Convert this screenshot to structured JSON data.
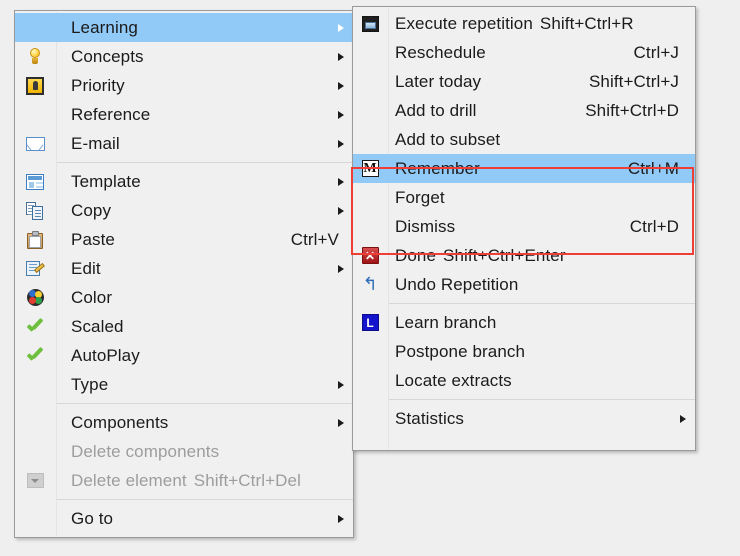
{
  "background_color": "#efefef",
  "highlight_color": "#91c9f7",
  "annotation": {
    "color": "#ef3e36",
    "target_items": [
      "Remember",
      "Forget",
      "Dismiss"
    ]
  },
  "left_menu": {
    "name": "element-context-menu",
    "items": [
      {
        "label": "Learning",
        "icon": "none",
        "shortcut": "",
        "submenu": true,
        "highlight": true,
        "disabled": false
      },
      {
        "label": "Concepts",
        "icon": "bulb-icon",
        "shortcut": "",
        "submenu": true,
        "highlight": false,
        "disabled": false
      },
      {
        "label": "Priority",
        "icon": "priority-icon",
        "shortcut": "",
        "submenu": true,
        "highlight": false,
        "disabled": false
      },
      {
        "label": "Reference",
        "icon": "none",
        "shortcut": "",
        "submenu": true,
        "highlight": false,
        "disabled": false
      },
      {
        "label": "E-mail",
        "icon": "mail-icon",
        "shortcut": "",
        "submenu": true,
        "highlight": false,
        "disabled": false
      },
      {
        "separator": true
      },
      {
        "label": "Template",
        "icon": "template-icon",
        "shortcut": "",
        "submenu": true,
        "highlight": false,
        "disabled": false
      },
      {
        "label": "Copy",
        "icon": "copy-icon",
        "shortcut": "",
        "submenu": true,
        "highlight": false,
        "disabled": false
      },
      {
        "label": "Paste",
        "icon": "paste-icon",
        "shortcut": "Ctrl+V",
        "submenu": false,
        "highlight": false,
        "disabled": false
      },
      {
        "label": "Edit",
        "icon": "edit-icon",
        "shortcut": "",
        "submenu": true,
        "highlight": false,
        "disabled": false
      },
      {
        "label": "Color",
        "icon": "color-icon",
        "shortcut": "",
        "submenu": false,
        "highlight": false,
        "disabled": false
      },
      {
        "label": "Scaled",
        "icon": "check-icon",
        "shortcut": "",
        "submenu": false,
        "highlight": false,
        "disabled": false
      },
      {
        "label": "AutoPlay",
        "icon": "check-icon",
        "shortcut": "",
        "submenu": false,
        "highlight": false,
        "disabled": false
      },
      {
        "label": "Type",
        "icon": "none",
        "shortcut": "",
        "submenu": true,
        "highlight": false,
        "disabled": false
      },
      {
        "separator": true
      },
      {
        "label": "Components",
        "icon": "none",
        "shortcut": "",
        "submenu": true,
        "highlight": false,
        "disabled": false
      },
      {
        "label": "Delete components",
        "icon": "none",
        "shortcut": "",
        "submenu": false,
        "highlight": false,
        "disabled": true
      },
      {
        "label": "Delete element",
        "icon": "dropbtn-icon",
        "shortcut": "Shift+Ctrl+Del",
        "submenu": false,
        "highlight": false,
        "disabled": true,
        "inline_shortcut": true
      },
      {
        "separator": true
      },
      {
        "label": "Go to",
        "icon": "none",
        "shortcut": "",
        "submenu": true,
        "highlight": false,
        "disabled": false
      }
    ]
  },
  "right_menu": {
    "name": "learning-submenu",
    "items": [
      {
        "label": "Execute repetition",
        "icon": "exec-icon",
        "shortcut": "Shift+Ctrl+R",
        "submenu": false,
        "highlight": false,
        "disabled": false,
        "inline_shortcut": true
      },
      {
        "label": "Reschedule",
        "icon": "none",
        "shortcut": "Ctrl+J",
        "submenu": false,
        "highlight": false,
        "disabled": false
      },
      {
        "label": "Later today",
        "icon": "none",
        "shortcut": "Shift+Ctrl+J",
        "submenu": false,
        "highlight": false,
        "disabled": false
      },
      {
        "label": "Add to drill",
        "icon": "none",
        "shortcut": "Shift+Ctrl+D",
        "submenu": false,
        "highlight": false,
        "disabled": false
      },
      {
        "label": "Add to subset",
        "icon": "none",
        "shortcut": "",
        "submenu": false,
        "highlight": false,
        "disabled": false
      },
      {
        "label": "Remember",
        "icon": "m-icon",
        "shortcut": "Ctrl+M",
        "submenu": false,
        "highlight": true,
        "disabled": false
      },
      {
        "label": "Forget",
        "icon": "none",
        "shortcut": "",
        "submenu": false,
        "highlight": false,
        "disabled": false
      },
      {
        "label": "Dismiss",
        "icon": "none",
        "shortcut": "Ctrl+D",
        "submenu": false,
        "highlight": false,
        "disabled": false
      },
      {
        "label": "Done",
        "icon": "x-icon",
        "shortcut": "Shift+Ctrl+Enter",
        "submenu": false,
        "highlight": false,
        "disabled": false,
        "inline_shortcut": true
      },
      {
        "label": "Undo Repetition",
        "icon": "undo-icon",
        "shortcut": "",
        "submenu": false,
        "highlight": false,
        "disabled": false
      },
      {
        "separator": true
      },
      {
        "label": "Learn branch",
        "icon": "l-icon",
        "shortcut": "",
        "submenu": false,
        "highlight": false,
        "disabled": false
      },
      {
        "label": "Postpone branch",
        "icon": "none",
        "shortcut": "",
        "submenu": false,
        "highlight": false,
        "disabled": false
      },
      {
        "label": "Locate extracts",
        "icon": "none",
        "shortcut": "",
        "submenu": false,
        "highlight": false,
        "disabled": false
      },
      {
        "separator": true
      },
      {
        "label": "Statistics",
        "icon": "none",
        "shortcut": "",
        "submenu": true,
        "highlight": false,
        "disabled": false
      }
    ]
  },
  "icon_glyphs": {
    "m-icon": "M",
    "x-icon": "✕",
    "undo-icon": "↰",
    "l-icon": "L"
  }
}
